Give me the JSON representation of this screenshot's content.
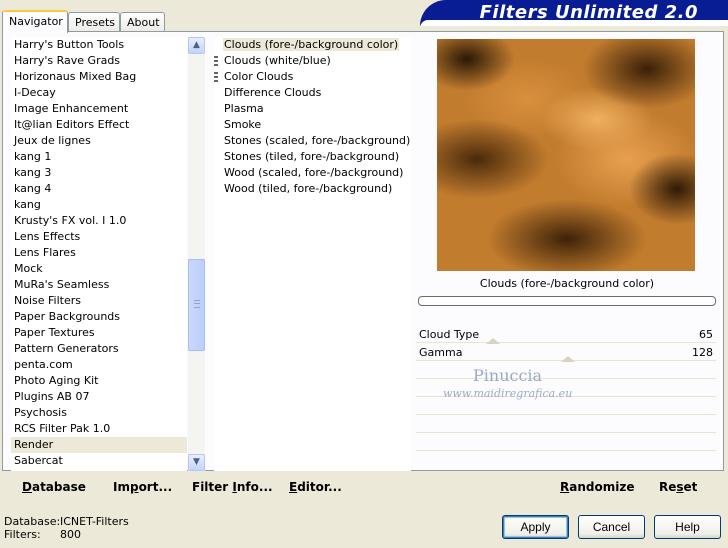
{
  "tabs": [
    {
      "label": "Navigator",
      "active": true
    },
    {
      "label": "Presets",
      "active": false
    },
    {
      "label": "About",
      "active": false
    }
  ],
  "app_title": "Filters Unlimited 2.0",
  "categories": [
    "Harry's Button Tools",
    "Harry's Rave Grads",
    "Horizonaus Mixed Bag",
    "I-Decay",
    "Image Enhancement",
    "It@lian Editors Effect",
    "Jeux de lignes",
    "kang 1",
    "kang 3",
    "kang 4",
    "kang",
    "Krusty's FX vol. I 1.0",
    "Lens Effects",
    "Lens Flares",
    "Mock",
    "MuRa's Seamless",
    "Noise Filters",
    "Paper Backgrounds",
    "Paper Textures",
    "Pattern Generators",
    "penta.com",
    "Photo Aging Kit",
    "Plugins AB 07",
    "Psychosis",
    "RCS Filter Pak 1.0",
    "Render",
    "Sabercat"
  ],
  "selected_category": "Render",
  "filters": [
    {
      "label": "Clouds (fore-/background color)",
      "mark": false,
      "selected": true
    },
    {
      "label": "Clouds (white/blue)",
      "mark": true,
      "selected": false
    },
    {
      "label": "Color Clouds",
      "mark": true,
      "selected": false
    },
    {
      "label": "Difference Clouds",
      "mark": false,
      "selected": false
    },
    {
      "label": "Plasma",
      "mark": false,
      "selected": false
    },
    {
      "label": "Smoke",
      "mark": false,
      "selected": false
    },
    {
      "label": "Stones (scaled, fore-/background)",
      "mark": false,
      "selected": false
    },
    {
      "label": "Stones (tiled, fore-/background)",
      "mark": false,
      "selected": false
    },
    {
      "label": "Wood (scaled, fore-/background)",
      "mark": false,
      "selected": false
    },
    {
      "label": "Wood (tiled, fore-/background)",
      "mark": false,
      "selected": false
    }
  ],
  "preview_caption": "Clouds (fore-/background color)",
  "parameters": [
    {
      "name": "Cloud Type",
      "value": "65"
    },
    {
      "name": "Gamma",
      "value": "128"
    }
  ],
  "watermark": {
    "name": "Pinuccia",
    "url": "www.maidiregrafica.eu"
  },
  "bottom_buttons": {
    "database": {
      "ul": "D",
      "rest": "atabase"
    },
    "import": {
      "pre": "Im",
      "ul": "p",
      "rest": "ort..."
    },
    "filter_info": {
      "pre": "Filter ",
      "ul": "I",
      "rest": "nfo..."
    },
    "editor": {
      "ul": "E",
      "rest": "ditor..."
    },
    "randomize": {
      "ul": "R",
      "rest": "andomize"
    },
    "reset": {
      "pre": "Re",
      "ul": "s",
      "rest": "et"
    }
  },
  "footer": {
    "database_label": "Database:",
    "database_value": "ICNET-Filters",
    "filters_label": "Filters:",
    "filters_value": "800"
  },
  "dialog_buttons": {
    "apply": "Apply",
    "cancel": "Cancel",
    "help": "Help"
  },
  "colors": {
    "title_bar": "#081c94",
    "dialog_bg": "#ece9d8",
    "preview_base": "#c27c2e"
  }
}
